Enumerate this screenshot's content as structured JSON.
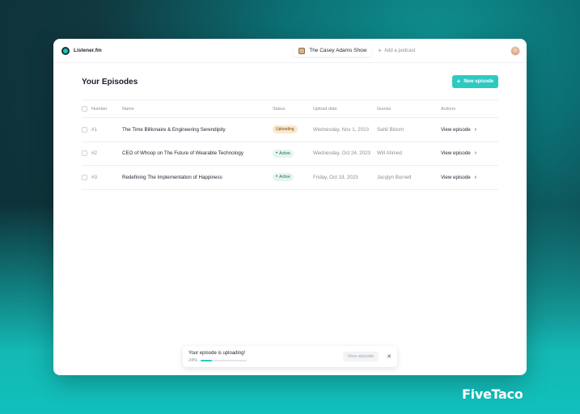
{
  "app": {
    "name": "Listener.fm"
  },
  "nav": {
    "current_show": "The Casey Adams Show",
    "add_podcast": "Add a podcast"
  },
  "page": {
    "title": "Your Episodes",
    "new_button": "New episode"
  },
  "table": {
    "headers": {
      "number": "Number",
      "name": "Name",
      "status": "Status",
      "upload_date": "Upload date",
      "guests": "Guests",
      "actions": "Actions"
    },
    "rows": [
      {
        "number": "#1",
        "name": "The Time Billionaire & Engineering Serendipity",
        "status": "Uploading",
        "status_kind": "uploading",
        "upload_date": "Wednesday, Nov 1, 2023",
        "guest": "Sahil Bloom",
        "action": "View episode"
      },
      {
        "number": "#2",
        "name": "CEO of Whoop on The Future of Wearable Technology",
        "status": "Active",
        "status_kind": "active",
        "upload_date": "Wednesday, Oct 24, 2023",
        "guest": "Will Ahmed",
        "action": "View episode"
      },
      {
        "number": "#3",
        "name": "Redefining The Implementation of Happiness",
        "status": "Active",
        "status_kind": "active",
        "upload_date": "Friday, Oct 19, 2023",
        "guest": "Jacqlyn Burnett",
        "action": "View episode"
      }
    ]
  },
  "toast": {
    "title": "Your episode is uploading!",
    "percent_label": "24%",
    "progress": 0.24,
    "button": "View episode"
  },
  "watermark": "FiveTaco",
  "colors": {
    "accent": "#2ec9c1",
    "uploading_bg": "#fbe8cc",
    "active_bg": "#e6f4ef"
  },
  "icons": {
    "logo": "listener-logo-icon",
    "plus": "plus-icon",
    "chevron": "chevron-right-icon",
    "close": "close-icon",
    "avatar": "avatar"
  }
}
